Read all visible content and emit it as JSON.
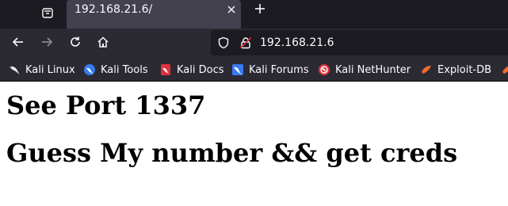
{
  "tab": {
    "title": "192.168.21.6/"
  },
  "urlbar": {
    "url": "192.168.21.6"
  },
  "bookmarks": [
    {
      "label": "Kali Linux",
      "icon": "kali-dragon-icon"
    },
    {
      "label": "Kali Tools",
      "icon": "kali-tools-icon"
    },
    {
      "label": "Kali Docs",
      "icon": "kali-docs-icon"
    },
    {
      "label": "Kali Forums",
      "icon": "kali-forums-icon"
    },
    {
      "label": "Kali NetHunter",
      "icon": "nethunter-icon"
    },
    {
      "label": "Exploit-DB",
      "icon": "exploit-db-icon"
    }
  ],
  "page": {
    "heading1": "See Port 1337",
    "heading2": "Guess My number && get creds"
  },
  "colors": {
    "tabstrip": "#1c1b22",
    "toolbar": "#2b2a33",
    "active_tab": "#42414d",
    "chrome_text": "#fbfbfe",
    "kali_red": "#e0313b",
    "kali_blue": "#367bf0",
    "exploit_orange": "#f36a2b"
  }
}
